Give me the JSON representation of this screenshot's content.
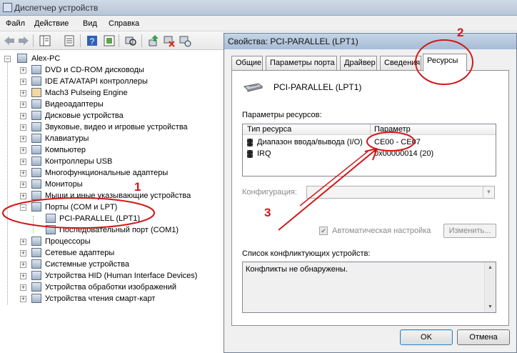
{
  "window": {
    "title": "Диспетчер устройств"
  },
  "menu": [
    "Файл",
    "Действие",
    "Вид",
    "Справка"
  ],
  "tree": {
    "root": "Alex-PC",
    "items": [
      {
        "label": "DVD и CD-ROM дисководы",
        "icon": "dvd-drive-icon"
      },
      {
        "label": "IDE ATA/ATAPI контроллеры",
        "icon": "ide-controller-icon"
      },
      {
        "label": "Mach3 Pulseing Engine",
        "icon": "gear-icon"
      },
      {
        "label": "Видеоадаптеры",
        "icon": "display-adapter-icon"
      },
      {
        "label": "Дисковые устройства",
        "icon": "disk-drive-icon"
      },
      {
        "label": "Звуковые, видео и игровые устройства",
        "icon": "speaker-icon"
      },
      {
        "label": "Клавиатуры",
        "icon": "keyboard-icon"
      },
      {
        "label": "Компьютер",
        "icon": "computer-icon"
      },
      {
        "label": "Контроллеры USB",
        "icon": "usb-icon"
      },
      {
        "label": "Многофункциональные адаптеры",
        "icon": "adapter-icon"
      },
      {
        "label": "Мониторы",
        "icon": "monitor-icon"
      },
      {
        "label": "Мыши и иные указывающие устройства",
        "icon": "mouse-icon"
      },
      {
        "label": "Порты (COM и LPT)",
        "icon": "port-icon",
        "expanded": true
      },
      {
        "label": "PCI-PARALLEL (LPT1)",
        "icon": "parallel-port-icon",
        "child": true
      },
      {
        "label": "Последовательный порт (COM1)",
        "icon": "serial-port-icon",
        "child": true
      },
      {
        "label": "Процессоры",
        "icon": "cpu-icon"
      },
      {
        "label": "Сетевые адаптеры",
        "icon": "network-adapter-icon"
      },
      {
        "label": "Системные устройства",
        "icon": "system-device-icon"
      },
      {
        "label": "Устройства HID (Human Interface Devices)",
        "icon": "hid-icon"
      },
      {
        "label": "Устройства обработки изображений",
        "icon": "camera-icon"
      },
      {
        "label": "Устройства чтения смарт-карт",
        "icon": "smartcard-icon"
      }
    ]
  },
  "dialog": {
    "title": "Свойства: PCI-PARALLEL (LPT1)",
    "tabs": [
      "Общие",
      "Параметры порта",
      "Драйвер",
      "Сведения",
      "Ресурсы"
    ],
    "active_tab": "Ресурсы",
    "device_name": "PCI-PARALLEL (LPT1)",
    "resources_label": "Параметры ресурсов:",
    "columns": [
      "Тип ресурса",
      "Параметр"
    ],
    "resources": [
      {
        "type": "Диапазон ввода/вывода (I/O)",
        "value": "CE00 - CE07"
      },
      {
        "type": "IRQ",
        "value": "0x00000014 (20)"
      }
    ],
    "config_label": "Конфигурация:",
    "config_value": "",
    "auto_config_label": "Автоматическая настройка",
    "auto_config_checked": true,
    "change_button": "Изменить...",
    "conflicts_label": "Список конфликтующих устройств:",
    "conflicts_text": "Конфликты не обнаружены.",
    "ok_button": "OK",
    "cancel_button": "Отмена"
  },
  "annotations": {
    "marker_1": "1",
    "marker_2": "2",
    "marker_3": "3",
    "color": "#d01818"
  }
}
